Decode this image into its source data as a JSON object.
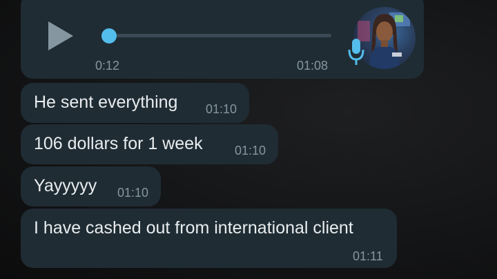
{
  "voice_note": {
    "elapsed": "0:12",
    "sent_time": "01:08",
    "progress": 0.03
  },
  "messages": [
    {
      "text": "He sent everything",
      "time": "01:10"
    },
    {
      "text": "106 dollars for 1 week",
      "time": "01:10"
    },
    {
      "text": "Yayyyyy",
      "time": "01:10"
    },
    {
      "text": "I have cashed out from international client",
      "time": "01:11"
    }
  ],
  "colors": {
    "bubble": "#1f2c34",
    "accent_blue": "#53bdeb",
    "text": "#e9edef",
    "meta_text": "#8696a0"
  },
  "icons": [
    "play-icon",
    "microphone-icon"
  ]
}
